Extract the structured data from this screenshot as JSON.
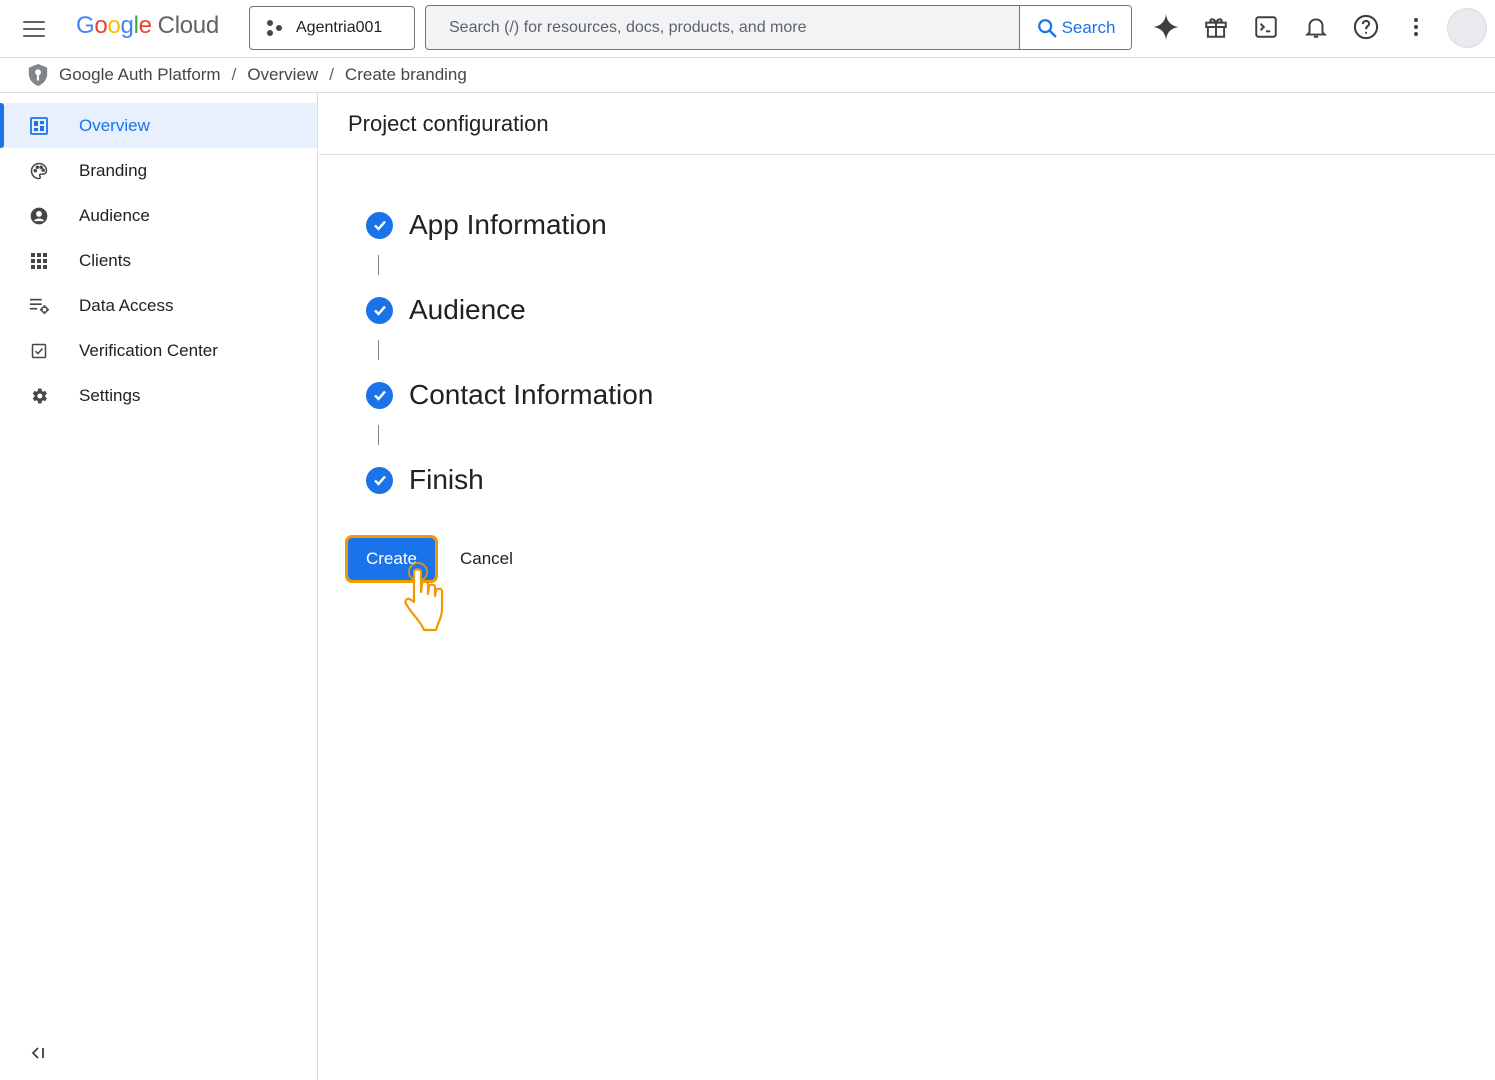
{
  "topbar": {
    "logo_google": [
      "G",
      "o",
      "o",
      "g",
      "l",
      "e"
    ],
    "logo_cloud": "Cloud",
    "project_name": "Agentria001",
    "search_placeholder": "Search (/) for resources, docs, products, and more",
    "search_button": "Search",
    "icons": [
      "menu-icon",
      "gemini-spark-icon",
      "gift-icon",
      "cloud-shell-icon",
      "notifications-icon",
      "help-icon",
      "more-vert-icon",
      "account-avatar"
    ]
  },
  "breadcrumb": {
    "items": [
      "Google Auth Platform",
      "Overview",
      "Create branding"
    ],
    "separator": "/"
  },
  "sidebar": {
    "items": [
      {
        "label": "Overview",
        "icon": "dashboard-icon",
        "active": true
      },
      {
        "label": "Branding",
        "icon": "palette-icon",
        "active": false
      },
      {
        "label": "Audience",
        "icon": "account-circle-icon",
        "active": false
      },
      {
        "label": "Clients",
        "icon": "apps-grid-icon",
        "active": false
      },
      {
        "label": "Data Access",
        "icon": "data-settings-icon",
        "active": false
      },
      {
        "label": "Verification Center",
        "icon": "verified-checkbox-icon",
        "active": false
      },
      {
        "label": "Settings",
        "icon": "gear-icon",
        "active": false
      }
    ],
    "collapse_icon": "collapse-sidebar-icon"
  },
  "main": {
    "title": "Project configuration",
    "steps": [
      {
        "label": "App Information",
        "status": "complete"
      },
      {
        "label": "Audience",
        "status": "complete"
      },
      {
        "label": "Contact Information",
        "status": "complete"
      },
      {
        "label": "Finish",
        "status": "complete"
      }
    ],
    "create_label": "Create",
    "cancel_label": "Cancel"
  },
  "colors": {
    "accent": "#1a73e8",
    "active_bg": "#e8f0fe",
    "highlight": "#f29900",
    "border": "#dadce0"
  }
}
